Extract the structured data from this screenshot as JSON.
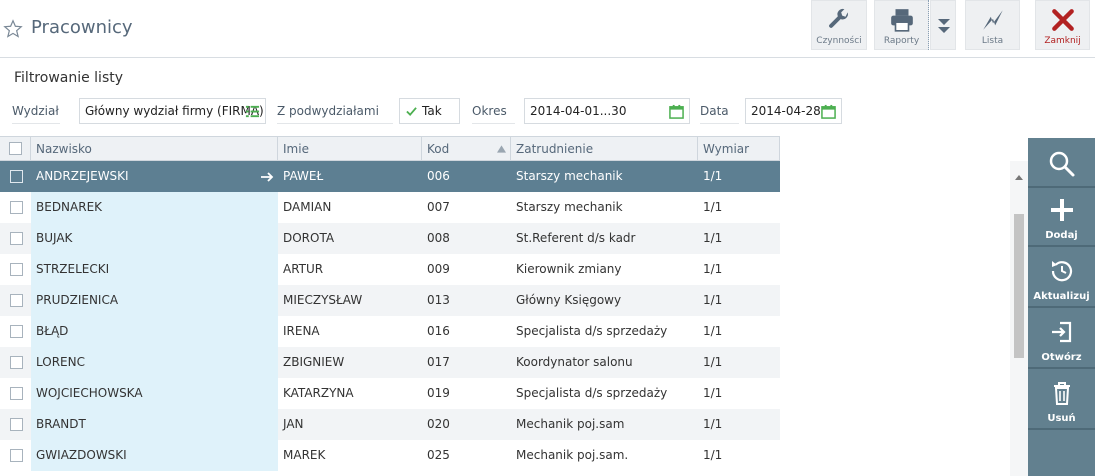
{
  "page": {
    "title": "Pracownicy"
  },
  "toolbar": {
    "czynnosci": "Czynności",
    "raporty": "Raporty",
    "lista": "Lista",
    "zamknij": "Zamknij",
    "icons": {
      "czynnosci": "wrench-icon",
      "raporty": "printer-icon",
      "more": "double-chevron-down-icon",
      "lista": "lightning-icon",
      "zamknij": "close-x-icon"
    },
    "close_color": "#b22222"
  },
  "filters": {
    "title": "Filtrowanie listy",
    "wydzial_label": "Wydział",
    "wydzial_value": "Główny wydział firmy (FIRMA)",
    "podwydzialy_label": "Z podwydziałami",
    "podwydzialy_value": "Tak",
    "okres_label": "Okres",
    "okres_value": "2014-04-01...30",
    "data_label": "Data",
    "data_value": "2014-04-28"
  },
  "grid": {
    "columns": [
      "Nazwisko",
      "Imie",
      "Kod",
      "Zatrudnienie",
      "Wymiar"
    ],
    "sort_column": "Kod",
    "sort_direction": "ascending",
    "rows": [
      {
        "nazwisko": "ANDRZEJEWSKI",
        "imie": "PAWEŁ",
        "kod": "006",
        "zatrudnienie": "Starszy mechanik",
        "wymiar": "1/1",
        "selected": true
      },
      {
        "nazwisko": "BEDNAREK",
        "imie": "DAMIAN",
        "kod": "007",
        "zatrudnienie": "Starszy mechanik",
        "wymiar": "1/1"
      },
      {
        "nazwisko": "BUJAK",
        "imie": "DOROTA",
        "kod": "008",
        "zatrudnienie": "St.Referent d/s kadr",
        "wymiar": "1/1"
      },
      {
        "nazwisko": "STRZELECKI",
        "imie": "ARTUR",
        "kod": "009",
        "zatrudnienie": "Kierownik zmiany",
        "wymiar": "1/1"
      },
      {
        "nazwisko": "PRUDZIENICA",
        "imie": "MIECZYSŁAW",
        "kod": "013",
        "zatrudnienie": "Główny Księgowy",
        "wymiar": "1/1"
      },
      {
        "nazwisko": "BŁĄD",
        "imie": "IRENA",
        "kod": "016",
        "zatrudnienie": "Specjalista d/s sprzedaży",
        "wymiar": "1/1"
      },
      {
        "nazwisko": "LORENC",
        "imie": "ZBIGNIEW",
        "kod": "017",
        "zatrudnienie": "Koordynator salonu",
        "wymiar": "1/1"
      },
      {
        "nazwisko": "WOJCIECHOWSKA",
        "imie": "KATARZYNA",
        "kod": "019",
        "zatrudnienie": "Specjalista d/s sprzedaży",
        "wymiar": "1/1"
      },
      {
        "nazwisko": "BRANDT",
        "imie": "JAN",
        "kod": "020",
        "zatrudnienie": "Mechanik poj.sam",
        "wymiar": "1/1"
      },
      {
        "nazwisko": "GWIAZDOWSKI",
        "imie": "MAREK",
        "kod": "025",
        "zatrudnienie": "Mechanik poj.sam.",
        "wymiar": "1/1"
      }
    ]
  },
  "sidebar": {
    "search_icon": "search-icon",
    "dodaj": "Dodaj",
    "aktualizuj": "Aktualizuj",
    "otworz": "Otwórz",
    "usun": "Usuń",
    "bg_color": "#62808f"
  },
  "colors": {
    "accent": "#5d7f92",
    "name_column_bg": "#dff2fa",
    "check_green": "#4caf50"
  }
}
